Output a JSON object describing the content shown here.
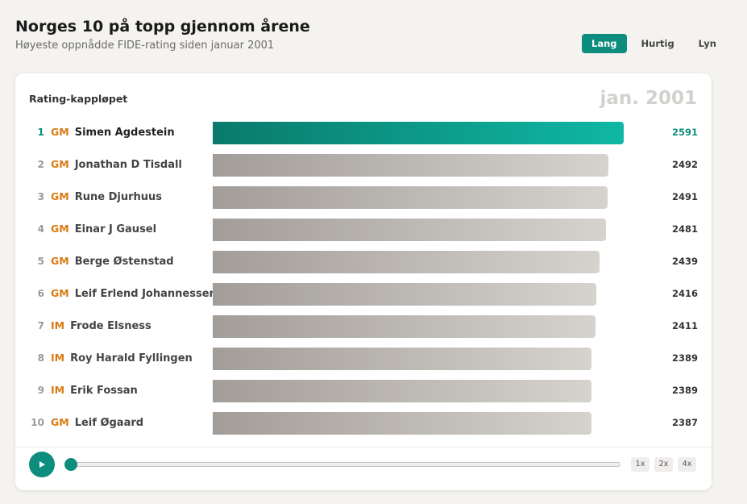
{
  "header": {
    "title": "Norges 10 på topp gjennom årene",
    "subtitle": "Høyeste oppnådde FIDE-rating siden januar 2001"
  },
  "tabs": [
    {
      "label": "Lang",
      "active": true
    },
    {
      "label": "Hurtig",
      "active": false
    },
    {
      "label": "Lyn",
      "active": false
    }
  ],
  "card": {
    "title": "Rating-kappløpet",
    "date": "jan. 2001"
  },
  "chart_data": {
    "type": "bar",
    "orientation": "horizontal",
    "categories": [
      "Simen Agdestein",
      "Jonathan D Tisdall",
      "Rune Djurhuus",
      "Einar J Gausel",
      "Berge Østenstad",
      "Leif Erlend Johannessen",
      "Frode Elsness",
      "Roy Harald Fyllingen",
      "Erik Fossan",
      "Leif Øgaard"
    ],
    "ranks": [
      "1",
      "2",
      "3",
      "4",
      "5",
      "6",
      "7",
      "8",
      "9",
      "10"
    ],
    "titles": [
      "GM",
      "GM",
      "GM",
      "GM",
      "GM",
      "GM",
      "IM",
      "IM",
      "IM",
      "GM"
    ],
    "values": [
      2591,
      2492,
      2491,
      2481,
      2439,
      2416,
      2411,
      2389,
      2389,
      2387
    ],
    "highlight_color": "#0d8d7e",
    "bar_color": "#a29d98",
    "title_color": "#d97a12"
  },
  "controls": {
    "progress": 0,
    "speeds": [
      "1x",
      "2x",
      "4x"
    ]
  },
  "icons": {
    "play": "play-icon"
  }
}
